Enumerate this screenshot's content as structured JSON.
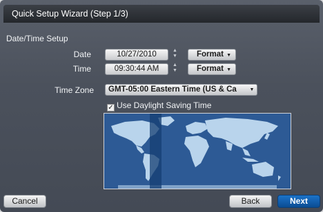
{
  "window": {
    "title": "Quick Setup Wizard (Step 1/3)"
  },
  "section": {
    "label": "Date/Time Setup"
  },
  "date": {
    "label": "Date",
    "value": "10/27/2010",
    "format_label": "Format"
  },
  "time": {
    "label": "Time",
    "value": "09:30:44 AM",
    "format_label": "Format"
  },
  "timezone": {
    "label": "Time Zone",
    "value": "GMT-05:00  Eastern Time (US & Ca"
  },
  "dst": {
    "label": "Use Daylight Saving Time",
    "checked": true
  },
  "buttons": {
    "cancel": "Cancel",
    "back": "Back",
    "next": "Next"
  },
  "colors": {
    "map_ocean": "#2d5a95",
    "map_land": "#b9d4ec",
    "map_selected_band": "#163f73",
    "primary_button": "#0e5aa7"
  }
}
